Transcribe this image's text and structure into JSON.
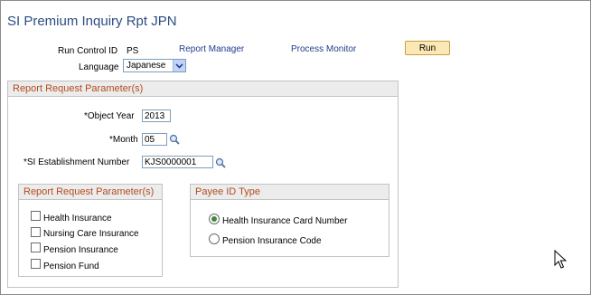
{
  "page": {
    "title": "SI Premium Inquiry Rpt JPN"
  },
  "run_control": {
    "label": "Run Control ID",
    "value": "PS",
    "report_manager": "Report Manager",
    "process_monitor": "Process Monitor",
    "run_label": "Run",
    "language_label": "Language",
    "language_value": "Japanese"
  },
  "params": {
    "header": "Report Request Parameter(s)",
    "object_year_label": "*Object Year",
    "object_year_value": "2013",
    "month_label": "*Month",
    "month_value": "05",
    "establishment_label": "*SI Establishment Number",
    "establishment_value": "KJS0000001"
  },
  "sub_params": {
    "header": "Report Request Parameter(s)",
    "checkboxes": [
      {
        "label": "Health Insurance",
        "checked": false
      },
      {
        "label": "Nursing Care Insurance",
        "checked": false
      },
      {
        "label": "Pension Insurance",
        "checked": false
      },
      {
        "label": "Pension Fund",
        "checked": false
      }
    ]
  },
  "payee": {
    "header": "Payee ID Type",
    "options": [
      {
        "label": "Health Insurance Card Number",
        "selected": true
      },
      {
        "label": "Pension Insurance Code",
        "selected": false
      }
    ]
  },
  "icons": {
    "lookup": "magnifier-icon",
    "dropdown": "chevron-down-icon",
    "cursor": "mouse-pointer-icon"
  },
  "colors": {
    "title": "#2b4e83",
    "link": "#1f3f8c",
    "group_header": "#b14c1f",
    "run_button": "#fce8b5"
  }
}
